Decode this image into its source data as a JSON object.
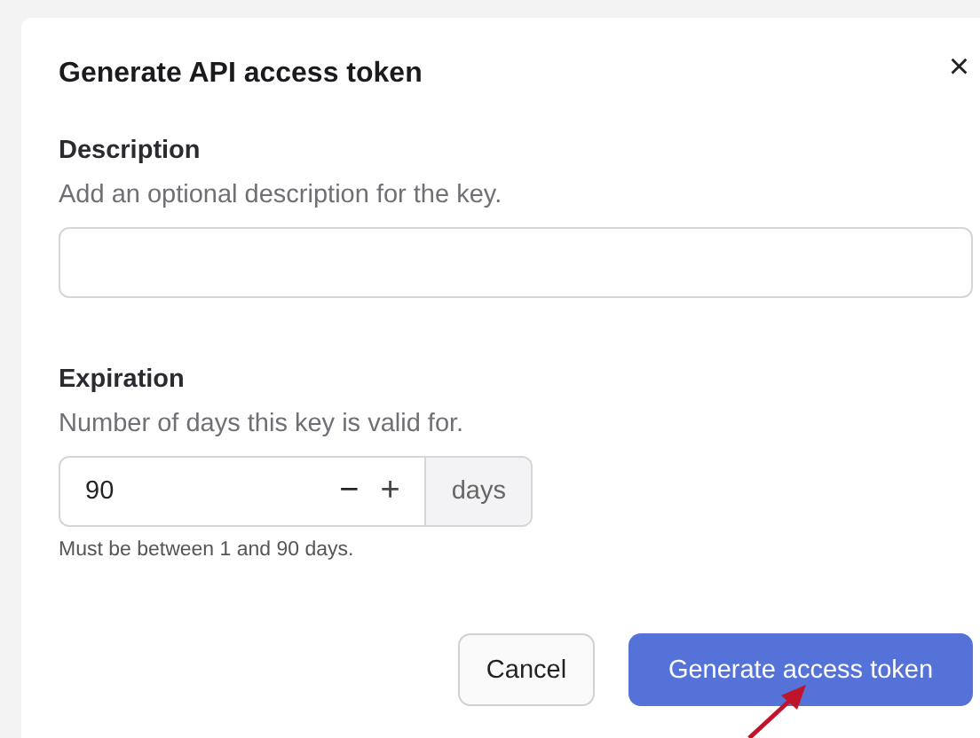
{
  "dialog": {
    "title": "Generate API access token",
    "close": "×"
  },
  "description": {
    "label": "Description",
    "hint": "Add an optional description for the key."
  },
  "expiration": {
    "label": "Expiration",
    "hint": "Number of days this key is valid for.",
    "value": "90",
    "decrement": "−",
    "increment": "+",
    "unit": "days",
    "help": "Must be between 1 and 90 days."
  },
  "buttons": [
    {
      "label": "Cancel",
      "kind": "secondary"
    },
    {
      "label": "Generate access token",
      "kind": "primary"
    }
  ]
}
